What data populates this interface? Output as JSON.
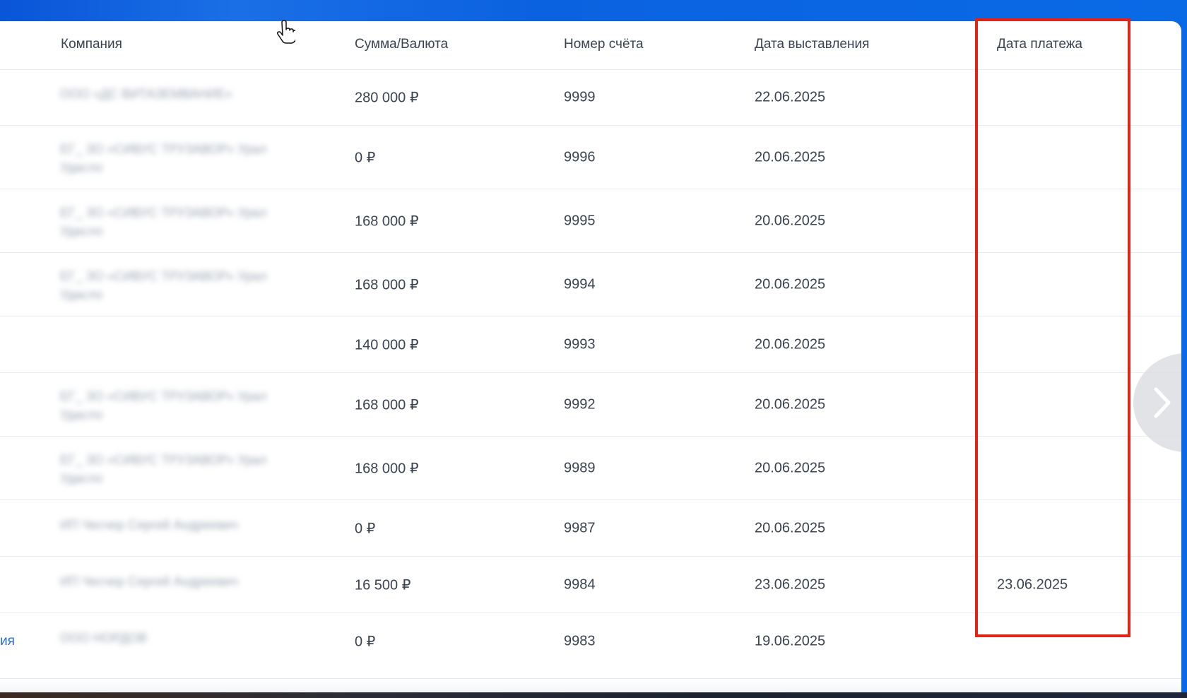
{
  "table": {
    "headers": {
      "company": "Компания",
      "amount": "Сумма/Валюта",
      "invoice_number": "Номер счёта",
      "issue_date": "Дата выставления",
      "payment_date": "Дата платежа"
    },
    "rows": [
      {
        "company": "ООО «ДС ВИТАЗЕМВАНИЕ»",
        "amount": "280 000 ₽",
        "invoice_number": "9999",
        "issue_date": "22.06.2025",
        "payment_date": ""
      },
      {
        "company": "ЕГ_ ЗО «СИВУС ТРУЗАВОР» Урал Удасло",
        "amount": "0 ₽",
        "invoice_number": "9996",
        "issue_date": "20.06.2025",
        "payment_date": ""
      },
      {
        "company": "ЕГ_ ЗО «СИВУС ТРУЗАВОР» Урал Удасло",
        "amount": "168 000 ₽",
        "invoice_number": "9995",
        "issue_date": "20.06.2025",
        "payment_date": ""
      },
      {
        "company": "ЕГ_ ЗО «СИВУС ТРУЗАВОР» Урал Удасло",
        "amount": "168 000 ₽",
        "invoice_number": "9994",
        "issue_date": "20.06.2025",
        "payment_date": ""
      },
      {
        "company": "",
        "amount": "140 000 ₽",
        "invoice_number": "9993",
        "issue_date": "20.06.2025",
        "payment_date": ""
      },
      {
        "company": "ЕГ_ ЗО «СИВУС ТРУЗАВОР» Урал Удасло",
        "amount": "168 000 ₽",
        "invoice_number": "9992",
        "issue_date": "20.06.2025",
        "payment_date": ""
      },
      {
        "company": "ЕГ_ ЗО «СИВУС ТРУЗАВОР» Урал Удасло",
        "amount": "168 000 ₽",
        "invoice_number": "9989",
        "issue_date": "20.06.2025",
        "payment_date": ""
      },
      {
        "company": "ИП Чесчер Сергей Андреевич",
        "amount": "0 ₽",
        "invoice_number": "9987",
        "issue_date": "20.06.2025",
        "payment_date": ""
      },
      {
        "company": "ИП Чесчер Сергей Андреевич",
        "amount": "16 500 ₽",
        "invoice_number": "9984",
        "issue_date": "23.06.2025",
        "payment_date": "23.06.2025"
      },
      {
        "company": "ООО НОРДОВ",
        "amount": "0 ₽",
        "invoice_number": "9983",
        "issue_date": "19.06.2025",
        "payment_date": ""
      }
    ],
    "cutoff_link_text": "ия"
  },
  "icons": {
    "next": "chevron-right-icon",
    "cursor": "hand-pointer-icon"
  },
  "colors": {
    "highlight": "#e02418",
    "accent_link": "#2a6ad6",
    "text": "#3b4351"
  }
}
